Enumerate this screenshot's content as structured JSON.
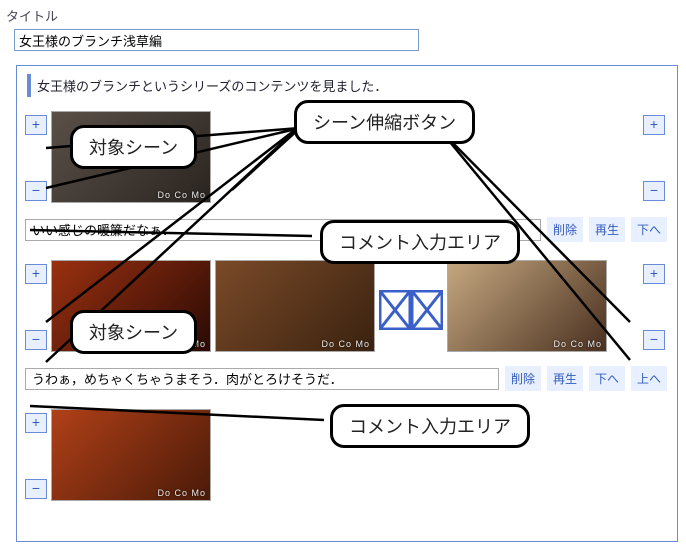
{
  "title_label": "タイトル",
  "title_value": "女王様のブランチ浅草編",
  "intro_text": "女王様のブランチというシリーズのコンテンツを見ました．",
  "buttons": {
    "plus": "+",
    "minus": "−",
    "delete": "削除",
    "play": "再生",
    "down": "下へ",
    "up": "上へ"
  },
  "watermark": "Do Co Mo",
  "scenes": [
    {
      "comment": "いい感じの暖簾だなぁ．",
      "thumbs": [
        {
          "kind": "noren"
        }
      ],
      "right_buttons": true,
      "actions": [
        "delete",
        "play",
        "down"
      ]
    },
    {
      "comment": "うわぁ，めちゃくちゃうまそう．肉がとろけそうだ．",
      "thumbs": [
        {
          "kind": "pot"
        },
        {
          "kind": "meat"
        },
        {
          "kind": "cross"
        },
        {
          "kind": "woman"
        }
      ],
      "right_buttons": true,
      "actions": [
        "delete",
        "play",
        "down",
        "up"
      ]
    },
    {
      "comment": "",
      "thumbs": [
        {
          "kind": "food"
        }
      ],
      "right_buttons": false,
      "actions": [],
      "partial": true
    }
  ],
  "annotations": {
    "target_scene": "対象シーン",
    "stretch_button": "シーン伸縮ボタン",
    "comment_area": "コメント入力エリア"
  }
}
